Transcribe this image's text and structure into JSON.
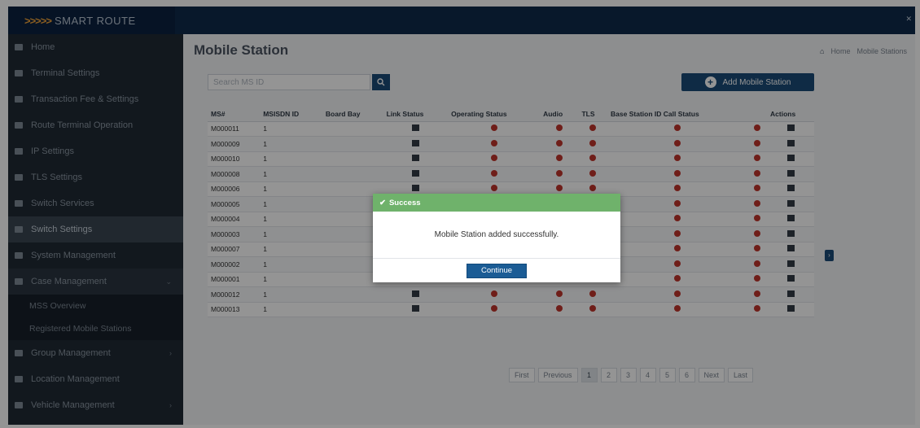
{
  "app": {
    "brand_mark": ">>>>>",
    "brand_name": "SMART ROUTE",
    "close_glyph": "✕"
  },
  "sidebar": {
    "items": [
      {
        "label": "Home"
      },
      {
        "label": "Terminal Settings"
      },
      {
        "label": "Transaction Fee & Settings"
      },
      {
        "label": "Route Terminal Operation"
      },
      {
        "label": "IP Settings"
      },
      {
        "label": "TLS Settings"
      },
      {
        "label": "Switch Services"
      },
      {
        "label": "Switch Settings"
      },
      {
        "label": "System Management"
      },
      {
        "label": "Case Management"
      }
    ],
    "sub_items": [
      {
        "label": "MSS Overview"
      },
      {
        "label": "Registered Mobile Stations"
      }
    ],
    "items_after": [
      {
        "label": "Group Management"
      },
      {
        "label": "Location Management"
      },
      {
        "label": "Vehicle Management"
      }
    ]
  },
  "page": {
    "title": "Mobile Station",
    "breadcrumb": [
      "Home",
      "Mobile Stations"
    ]
  },
  "search": {
    "placeholder": "Search MS ID",
    "button_icon": "search-icon"
  },
  "add_button": {
    "label": "Add Mobile Station"
  },
  "table": {
    "columns": [
      "MS#",
      "MSISDN ID",
      "Board Bay",
      "Link Status",
      "Operating Status",
      "Audio",
      "TLS",
      "Base Station ID Call Status",
      "",
      "Actions"
    ],
    "rows": [
      {
        "ms": "M000011",
        "msisdn": "1"
      },
      {
        "ms": "M000009",
        "msisdn": "1"
      },
      {
        "ms": "M000010",
        "msisdn": "1"
      },
      {
        "ms": "M000008",
        "msisdn": "1"
      },
      {
        "ms": "M000006",
        "msisdn": "1"
      },
      {
        "ms": "M000005",
        "msisdn": "1"
      },
      {
        "ms": "M000004",
        "msisdn": "1"
      },
      {
        "ms": "M000003",
        "msisdn": "1"
      },
      {
        "ms": "M000007",
        "msisdn": "1"
      },
      {
        "ms": "M000002",
        "msisdn": "1"
      },
      {
        "ms": "M000001",
        "msisdn": "1"
      },
      {
        "ms": "M000012",
        "msisdn": "1"
      },
      {
        "ms": "M000013",
        "msisdn": "1"
      }
    ]
  },
  "pagination": {
    "items": [
      "First",
      "Previous",
      "1",
      "2",
      "3",
      "4",
      "5",
      "6",
      "Next",
      "Last"
    ],
    "current": "1"
  },
  "modal": {
    "title": "Success",
    "message": "Mobile Station added successfully.",
    "button": "Continue"
  },
  "colors": {
    "topbar": "#0e2a4a",
    "sidebar": "#1f2a35",
    "primary": "#1b4b78",
    "success_header": "#6fb26b",
    "status_dot": "#c0342c"
  }
}
